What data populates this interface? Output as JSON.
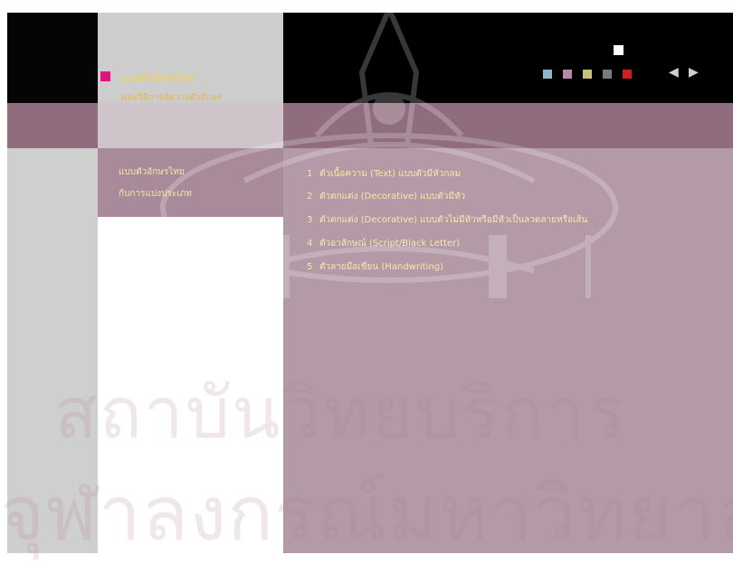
{
  "header": {
    "title_line1": "แบบตัวอักษรไทย",
    "title_line2": "และวิธีการจัดวางตัวอักษร"
  },
  "nav": {
    "squares": [
      {
        "name": "section-1",
        "color": "#8fb7cc"
      },
      {
        "name": "section-2",
        "color": "#b58aa8"
      },
      {
        "name": "section-3",
        "color": "#c8c07a"
      },
      {
        "name": "section-4",
        "color": "#7a7a7a"
      },
      {
        "name": "section-5",
        "color": "#cf2020"
      }
    ],
    "prev_glyph": "◀",
    "next_glyph": "▶"
  },
  "sidebar": {
    "label_line1": "แบบตัวอักษรไทย",
    "label_line2": "กับการแบ่งประเภท"
  },
  "list": [
    {
      "num": "1",
      "text": "ตัวเนื้อความ (Text) แบบตัวมีหัวกลม"
    },
    {
      "num": "2",
      "text": "ตัวตกแต่ง (Decorative) แบบตัวมีหัว"
    },
    {
      "num": "3",
      "text": "ตัวตกแต่ง (Decorative) แบบตัวไม่มีหัวหรือมีหัวเป็นลวดลายหรือเส้น"
    },
    {
      "num": "4",
      "text": "ตัวอาลักษณ์ (Script/Black Letter)"
    },
    {
      "num": "5",
      "text": "ตัวลายมือเขียน (Handwriting)"
    }
  ],
  "watermark": {
    "line1": "สถาบันวิทยบริการ",
    "line2": "จุฬาลงกรณ์มหาวิทยาลัย"
  },
  "colors": {
    "accent_magenta": "#e0147a",
    "mauve": "#8f6d7e",
    "content_bg": "#b49aa7",
    "text_yellow": "#f5eaa8"
  }
}
